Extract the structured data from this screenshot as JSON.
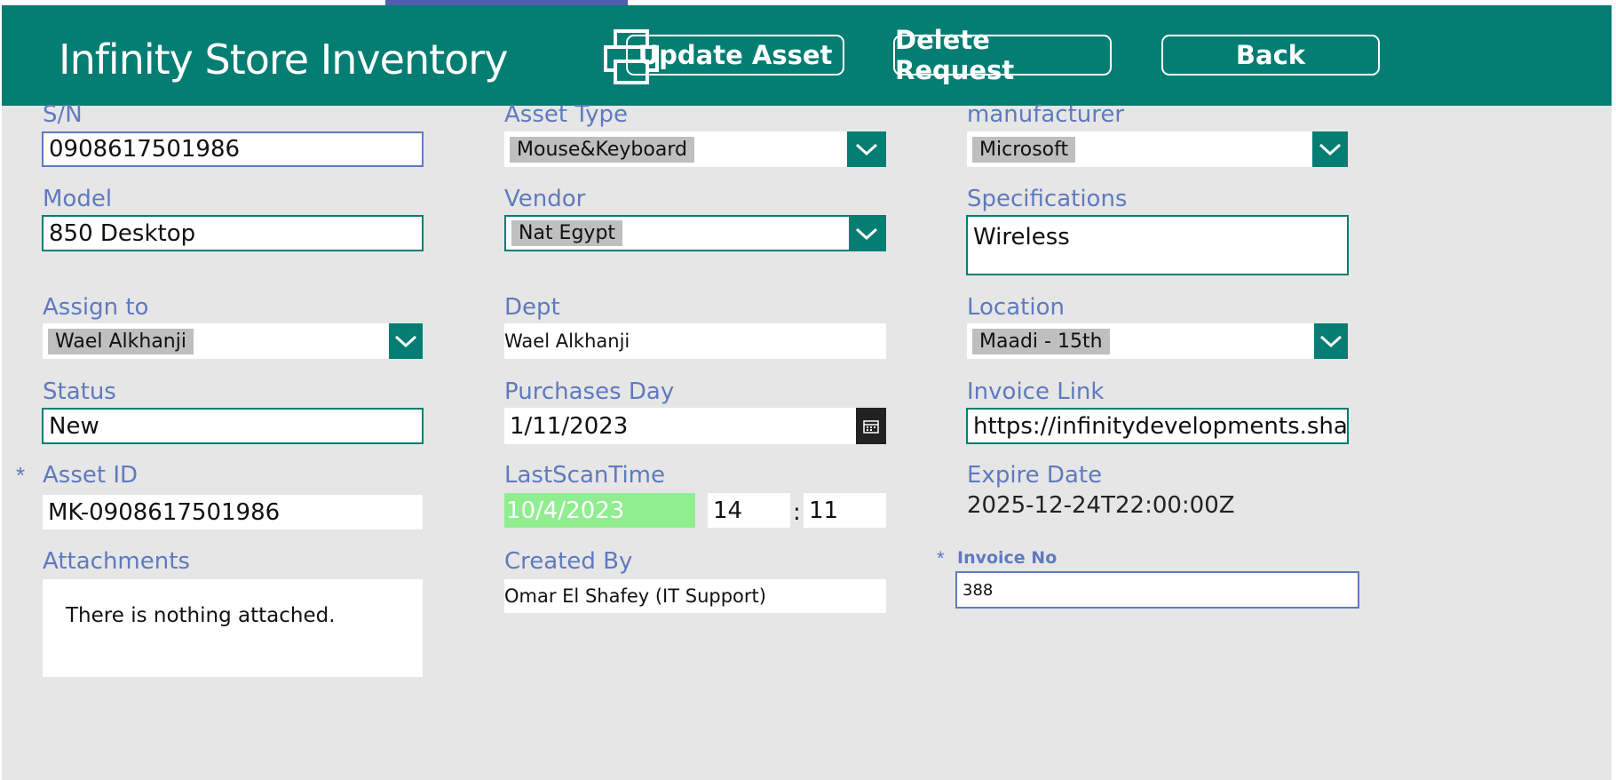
{
  "header": {
    "title": "Infinity Store Inventory",
    "buttons": {
      "update": "Update Asset",
      "delete": "Delete Request",
      "back": "Back"
    }
  },
  "fields": {
    "sn": {
      "label": "S/N",
      "value": "0908617501986"
    },
    "asset_type": {
      "label": "Asset Type",
      "value": "Mouse&Keyboard"
    },
    "manufacturer": {
      "label": "manufacturer",
      "value": "Microsoft"
    },
    "model": {
      "label": "Model",
      "value": "850 Desktop"
    },
    "vendor": {
      "label": "Vendor",
      "value": "Nat Egypt"
    },
    "specifications": {
      "label": "Specifications",
      "value": "Wireless"
    },
    "assign_to": {
      "label": "Assign to",
      "value": "Wael Alkhanji"
    },
    "dept": {
      "label": "Dept",
      "value": "Wael Alkhanji"
    },
    "location": {
      "label": "Location",
      "value": "Maadi - 15th"
    },
    "status": {
      "label": "Status",
      "value": "New"
    },
    "purchases_day": {
      "label": "Purchases Day",
      "value": "1/11/2023"
    },
    "invoice_link": {
      "label": "Invoice Link",
      "value": "https://infinitydevelopments.sharepoint"
    },
    "asset_id": {
      "label": "Asset ID",
      "value": "MK-0908617501986",
      "required_mark": "*"
    },
    "last_scan_time": {
      "label": "LastScanTime",
      "date": "10/4/2023",
      "hour": "14",
      "separator": ":",
      "minute": "11"
    },
    "expire_date": {
      "label": "Expire Date",
      "value": "2025-12-24T22:00:00Z"
    },
    "attachments": {
      "label": "Attachments",
      "value": "There is nothing attached."
    },
    "created_by": {
      "label": "Created By",
      "value": "Omar El Shafey (IT Support)"
    },
    "invoice_no": {
      "label": "Invoice No",
      "value": "388",
      "required_mark": "*"
    }
  },
  "colors": {
    "brand": "#047d72",
    "label": "#5f7ac0",
    "highlight": "#90ee90",
    "background": "#e6e6e6"
  },
  "icons": [
    "printer-icon",
    "chevron-down-icon",
    "calendar-icon"
  ]
}
